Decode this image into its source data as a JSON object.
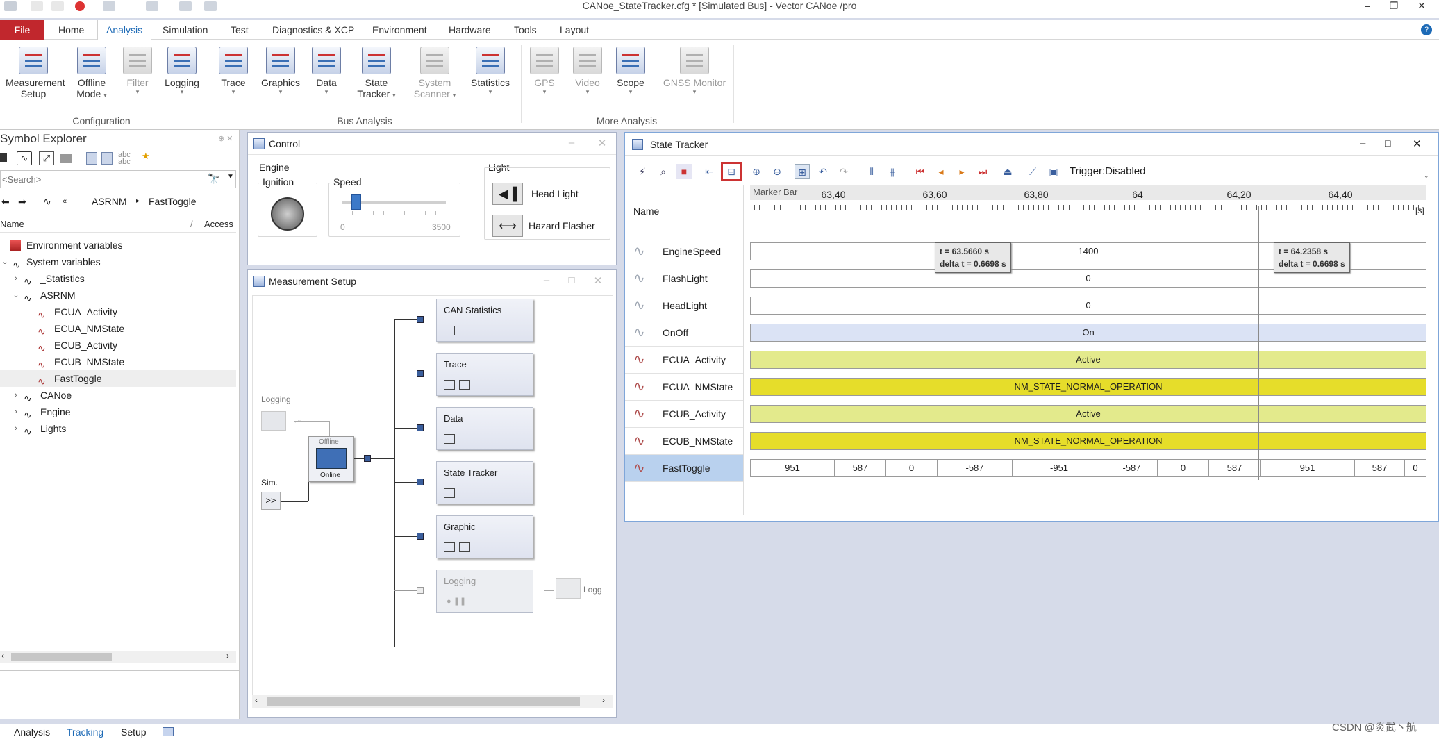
{
  "title": "CANoe_StateTracker.cfg * [Simulated Bus] - Vector CANoe /pro",
  "window_controls": {
    "minimize": "–",
    "restore": "❐",
    "close": "✕"
  },
  "menu": {
    "file": "File",
    "tabs": [
      "Home",
      "Analysis",
      "Simulation",
      "Test",
      "Diagnostics & XCP",
      "Environment",
      "Hardware",
      "Tools",
      "Layout"
    ],
    "active": "Analysis"
  },
  "ribbon": {
    "config": {
      "group": "Configuration",
      "buttons": [
        {
          "l1": "Measurement",
          "l2": "Setup",
          "caret": ""
        },
        {
          "l1": "Offline",
          "l2": "Mode",
          "caret": "▾"
        },
        {
          "l1": "Filter",
          "l2": "",
          "caret": "▾"
        },
        {
          "l1": "Logging",
          "l2": "",
          "caret": "▾"
        }
      ]
    },
    "bus": {
      "group": "Bus Analysis",
      "buttons": [
        {
          "l1": "Trace",
          "l2": "",
          "caret": "▾"
        },
        {
          "l1": "Graphics",
          "l2": "",
          "caret": "▾"
        },
        {
          "l1": "Data",
          "l2": "",
          "caret": "▾"
        },
        {
          "l1": "State",
          "l2": "Tracker",
          "caret": "▾"
        },
        {
          "l1": "System",
          "l2": "Scanner",
          "caret": "▾"
        },
        {
          "l1": "Statistics",
          "l2": "",
          "caret": "▾"
        }
      ]
    },
    "more": {
      "group": "More Analysis",
      "buttons": [
        {
          "l1": "GPS",
          "l2": "",
          "caret": "▾"
        },
        {
          "l1": "Video",
          "l2": "",
          "caret": "▾"
        },
        {
          "l1": "Scope",
          "l2": "",
          "caret": "▾"
        },
        {
          "l1": "GNSS Monitor",
          "l2": "",
          "caret": "▾"
        }
      ]
    }
  },
  "symbol_explorer": {
    "title": "Symbol Explorer",
    "search_placeholder": "<Search>",
    "path": [
      "ASRNM",
      "FastToggle"
    ],
    "col_name": "Name",
    "col_access": "Access",
    "tree": [
      {
        "label": "Environment variables",
        "exp": ""
      },
      {
        "label": "System variables",
        "exp": "⌄"
      },
      {
        "label": "_Statistics",
        "exp": "›"
      },
      {
        "label": "ASRNM",
        "exp": "⌄"
      },
      {
        "label": "ECUA_Activity",
        "exp": ""
      },
      {
        "label": "ECUA_NMState",
        "exp": ""
      },
      {
        "label": "ECUB_Activity",
        "exp": ""
      },
      {
        "label": "ECUB_NMState",
        "exp": ""
      },
      {
        "label": "FastToggle",
        "exp": ""
      },
      {
        "label": "CANoe",
        "exp": "›"
      },
      {
        "label": "Engine",
        "exp": "›"
      },
      {
        "label": "Lights",
        "exp": "›"
      }
    ]
  },
  "control": {
    "title": "Control",
    "engine": "Engine",
    "ignition": "Ignition",
    "speed": "Speed",
    "speed_min": "0",
    "speed_max": "3500",
    "speed_fraction": 0.14,
    "light": "Light",
    "head_light": "Head Light",
    "hazard_flasher": "Hazard Flasher"
  },
  "measurement": {
    "title": "Measurement Setup",
    "logging_left": "Logging",
    "sim": "Sim.",
    "sim_btn": ">>",
    "offline": "Offline",
    "online": "Online",
    "blocks": [
      "CAN Statistics",
      "Trace",
      "Data",
      "State Tracker",
      "Graphic",
      "Logging"
    ],
    "logging_right": "Logg"
  },
  "state_tracker": {
    "title": "State Tracker",
    "trigger": "Trigger:Disabled",
    "marker_bar": "Marker Bar",
    "name_col": "Name",
    "unit": "[s]",
    "ticks": [
      "63,40",
      "63,60",
      "63,80",
      "64",
      "64,20",
      "64,40"
    ],
    "cursor1": {
      "t": "t = 63.5660 s",
      "dt": "delta t = 0.6698 s"
    },
    "cursor2": {
      "t": "t = 64.2358 s",
      "dt": "delta t = 0.6698 s"
    },
    "signals": [
      {
        "name": "EngineSpeed",
        "value": "1400"
      },
      {
        "name": "FlashLight",
        "value": "0"
      },
      {
        "name": "HeadLight",
        "value": "0"
      },
      {
        "name": "OnOff",
        "value": "On"
      },
      {
        "name": "ECUA_Activity",
        "value": "Active"
      },
      {
        "name": "ECUA_NMState",
        "value": "NM_STATE_NORMAL_OPERATION"
      },
      {
        "name": "ECUB_Activity",
        "value": "Active"
      },
      {
        "name": "ECUB_NMState",
        "value": "NM_STATE_NORMAL_OPERATION"
      },
      {
        "name": "FastToggle",
        "value": ""
      }
    ],
    "fasttoggle": [
      "951",
      "587",
      "0",
      "-587",
      "-951",
      "-587",
      "0",
      "587",
      "951",
      "587",
      "0"
    ]
  },
  "status": {
    "tabs": [
      "Analysis",
      "Tracking",
      "Setup"
    ],
    "watermark": "CSDN @炎武丶航"
  },
  "colors": {
    "file_tab": "#c1272d",
    "accent": "#1d6ab6",
    "onoff": "#dbe3f5",
    "activity": "#e3ea8c",
    "nmstate": "#e6dd2a",
    "selected_row": "#b9d1ee"
  }
}
